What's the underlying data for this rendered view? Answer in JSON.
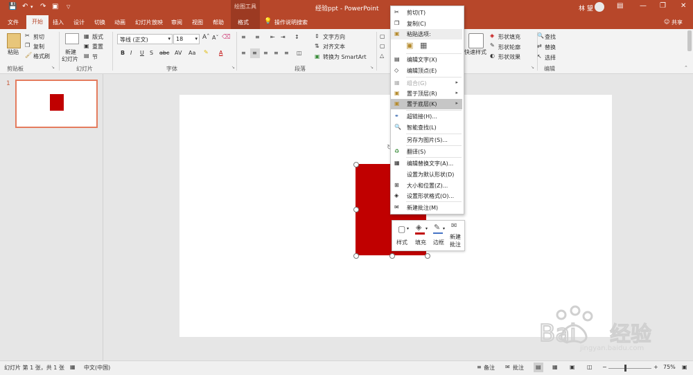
{
  "titlebar": {
    "context_tab": "绘图工具",
    "doc_title": "经验ppt - PowerPoint",
    "user": "林 望"
  },
  "tabs": {
    "file": "文件",
    "home": "开始",
    "insert": "插入",
    "design": "设计",
    "transitions": "切换",
    "animations": "动画",
    "slideshow": "幻灯片放映",
    "review": "审阅",
    "view": "视图",
    "help": "帮助",
    "format": "格式",
    "tell_me": "操作说明搜索",
    "share": "共享"
  },
  "ribbon": {
    "paste": "粘贴",
    "cut": "剪切",
    "copy": "复制",
    "format_painter": "格式刷",
    "clipboard_group": "剪贴板",
    "new_slide_1": "新建",
    "new_slide_2": "幻灯片",
    "layout": "版式",
    "reset": "重置",
    "section": "节",
    "slides_group": "幻灯片",
    "font_name": "等线 (正文)",
    "font_size": "18",
    "font_group": "字体",
    "text_direction": "文字方向",
    "align_text": "对齐文本",
    "smartart": "转换为 SmartArt",
    "paragraph_group": "段落",
    "quick_styles": "快速样式",
    "shape_fill": "形状填充",
    "shape_outline": "形状轮廓",
    "shape_effects": "形状效果",
    "find": "查找",
    "replace": "替换",
    "select": "选择",
    "editing_group": "编辑"
  },
  "slides_pane": {
    "slide_number": "1"
  },
  "context_menu": {
    "items": [
      {
        "label": "剪切(T)"
      },
      {
        "label": "复制(C)"
      },
      {
        "label": "粘贴选项:"
      },
      {
        "label": "编辑文字(X)"
      },
      {
        "label": "编辑顶点(E)"
      },
      {
        "label": "组合(G)"
      },
      {
        "label": "置于顶层(R)"
      },
      {
        "label": "置于底层(K)"
      },
      {
        "label": "超链接(H)..."
      },
      {
        "label": "智能查找(L)"
      },
      {
        "label": "另存为图片(S)..."
      },
      {
        "label": "翻译(S)"
      },
      {
        "label": "编辑替换文字(A)..."
      },
      {
        "label": "设置为默认形状(D)"
      },
      {
        "label": "大小和位置(Z)..."
      },
      {
        "label": "设置形状格式(O)..."
      },
      {
        "label": "新建批注(M)"
      }
    ]
  },
  "minibar": {
    "style": "样式",
    "fill": "填充",
    "outline": "边框",
    "new_comment_1": "新建",
    "new_comment_2": "批注"
  },
  "statusbar": {
    "slide_info": "幻灯片 第 1 张，共 1 张",
    "language": "中文(中国)",
    "notes": "备注",
    "comments": "批注",
    "zoom": "75%"
  },
  "watermark": {
    "text": "jingyan.baidu.com"
  },
  "colors": {
    "accent": "#b7472a",
    "shape_fill": "#c00000"
  }
}
